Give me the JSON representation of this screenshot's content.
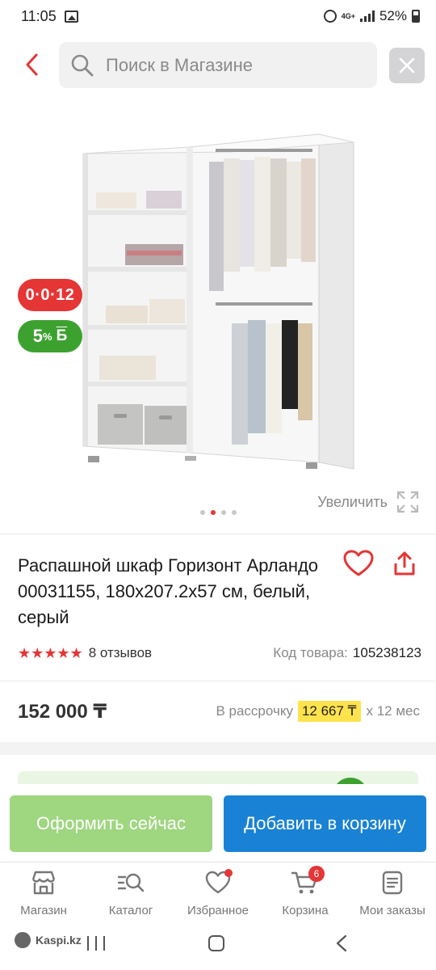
{
  "status_bar": {
    "time": "11:05",
    "network": "4G+",
    "battery": "52%",
    "icons": [
      "gallery-icon",
      "alarm-icon",
      "signal-icon",
      "battery-icon"
    ]
  },
  "search": {
    "placeholder": "Поиск в Магазине"
  },
  "product_image": {
    "badges": {
      "installment": "0·0·12",
      "bonus_percent": "5",
      "bonus_percent_sign": "%",
      "bonus_currency": "Б"
    },
    "zoom_label": "Увеличить",
    "gallery": {
      "count": 4,
      "active_index": 1
    }
  },
  "product": {
    "title": "Распашной шкаф Горизонт Арландо 00031155, 180х207.2х57 см, белый, серый",
    "rating": 5,
    "stars": "★★★★★",
    "reviews": "8 отзывов",
    "code_label": "Код товара:",
    "code_value": "105238123",
    "price": "152 000 ₸",
    "installment_label": "В рассрочку",
    "installment_monthly": "12 667 ₸",
    "installment_term": "х 12 мес"
  },
  "actions": {
    "buy_now": "Оформить сейчас",
    "add_to_cart": "Добавить в корзину"
  },
  "bottom_nav": {
    "items": [
      {
        "label": "Магазин",
        "icon": "store-icon"
      },
      {
        "label": "Каталог",
        "icon": "catalog-icon"
      },
      {
        "label": "Избранное",
        "icon": "heart-icon"
      },
      {
        "label": "Корзина",
        "icon": "cart-icon",
        "badge": "6"
      },
      {
        "label": "Мои заказы",
        "icon": "orders-icon"
      }
    ]
  },
  "system_bar": {
    "brand": "Kaspi.kz"
  },
  "colors": {
    "accent_red": "#e53535",
    "bonus_green": "#3da130",
    "buy_button": "#9fd680",
    "cart_button": "#1a82d4",
    "installment_highlight": "#ffe34d"
  }
}
